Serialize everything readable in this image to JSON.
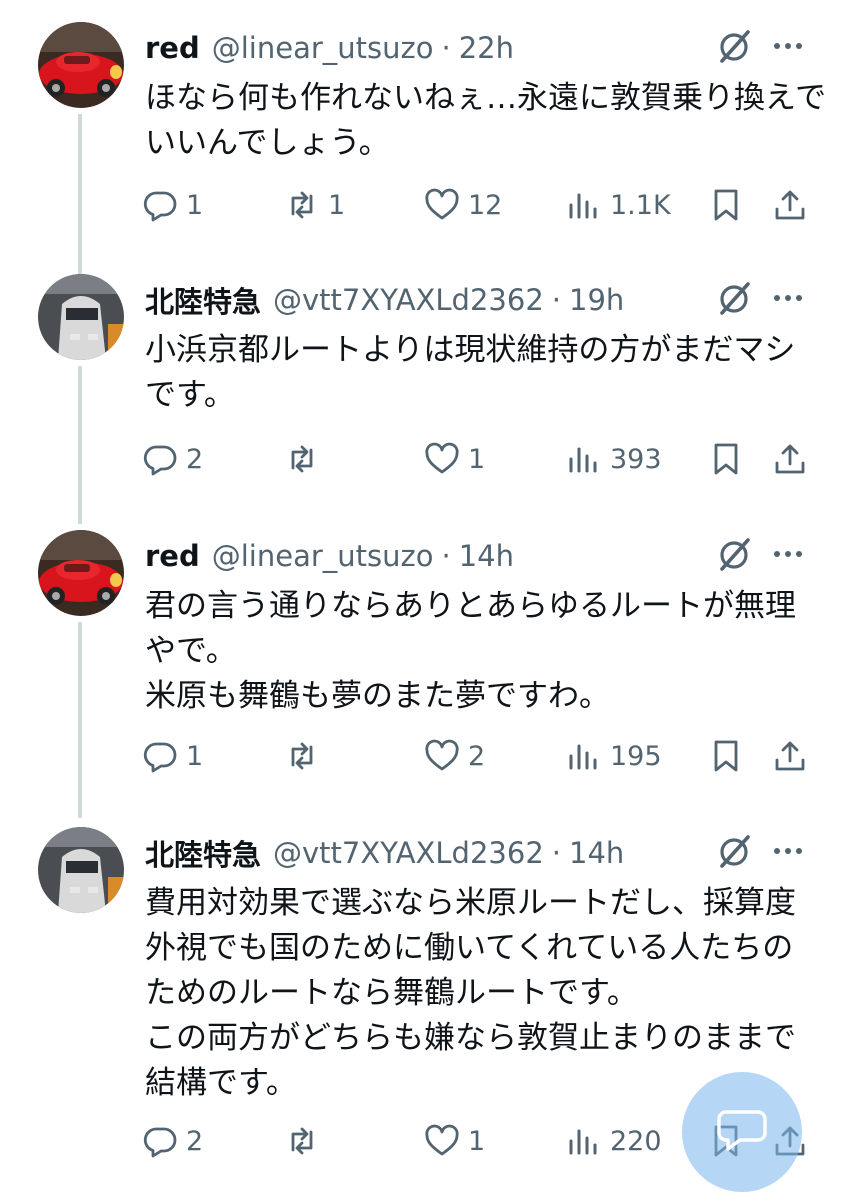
{
  "tweets": [
    {
      "name": "red",
      "handle": "@linear_utsuzo",
      "separator": "·",
      "time": "22h",
      "lines": [
        "ほなら何も作れないねぇ…永遠に敦賀乗り換えで",
        "いいんでしょう。"
      ],
      "replies": "1",
      "reposts": "1",
      "likes": "12",
      "views": "1.1K"
    },
    {
      "name": "北陸特急",
      "handle": "@vtt7XYAXLd2362",
      "separator": "·",
      "time": "19h",
      "lines": [
        "小浜京都ルートよりは現状維持の方がまだマシ",
        "です。"
      ],
      "replies": "2",
      "reposts": "",
      "likes": "1",
      "views": "393"
    },
    {
      "name": "red",
      "handle": "@linear_utsuzo",
      "separator": "·",
      "time": "14h",
      "lines": [
        "君の言う通りならありとあらゆるルートが無理",
        "やで。",
        "米原も舞鶴も夢のまた夢ですわ。"
      ],
      "replies": "1",
      "reposts": "",
      "likes": "2",
      "views": "195"
    },
    {
      "name": "北陸特急",
      "handle": "@vtt7XYAXLd2362",
      "separator": "·",
      "time": "14h",
      "lines": [
        "費用対効果で選ぶなら米原ルートだし、採算度",
        "外視でも国のために働いてくれている人たちの",
        "ためのルートなら舞鶴ルートです。",
        "この両方がどちらも嫌なら敦賀止まりのままで",
        "結構です。"
      ],
      "replies": "2",
      "reposts": "",
      "likes": "1",
      "views": "220"
    }
  ],
  "icons": {
    "reply": "reply-bubble-icon",
    "repost": "repost-arrows-icon",
    "like": "heart-icon",
    "views": "bar-chart-icon",
    "bookmark": "bookmark-icon",
    "share": "share-upload-icon",
    "grok": "grok-slash-circle-icon",
    "more": "more-dots-icon",
    "compose": "new-message-icon"
  },
  "colors": {
    "text": "#0f1419",
    "secondary": "#536471",
    "thread_line": "#cfd9de",
    "fab": "#78b6ec"
  }
}
